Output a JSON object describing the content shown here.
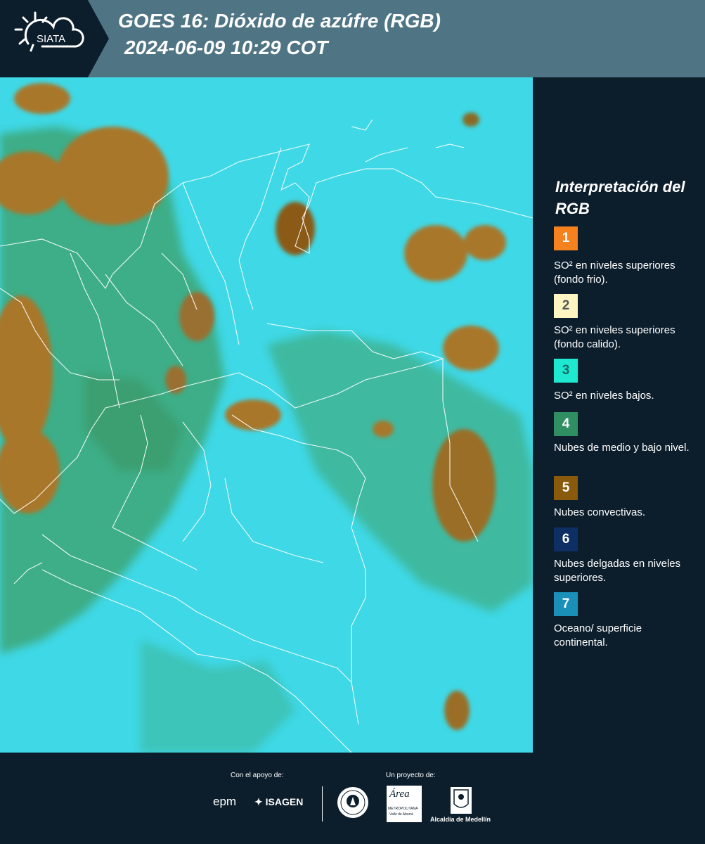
{
  "header": {
    "logo_text": "SIATA",
    "title_line1": "GOES 16: Dióxido de azúfre (RGB)",
    "title_line2": "2024-06-09 10:29 COT"
  },
  "legend": {
    "title": "Interpretación del RGB",
    "items": [
      {
        "num": "1",
        "color": "#f5821f",
        "num_color": "#ffffff",
        "label": "SO² en niveles superiores (fondo frio)."
      },
      {
        "num": "2",
        "color": "#fdf6c3",
        "num_color": "#555555",
        "label": "SO² en niveles superiores (fondo calido)."
      },
      {
        "num": "3",
        "color": "#1ee8d0",
        "num_color": "#1a6a66",
        "label": "SO² en niveles bajos."
      },
      {
        "num": "4",
        "color": "#2f8f63",
        "num_color": "#ffffff",
        "label": "Nubes de medio y bajo nivel."
      },
      {
        "num": "5",
        "color": "#8a5a0c",
        "num_color": "#ffffff",
        "label": "Nubes convectivas."
      },
      {
        "num": "6",
        "color": "#0d2f63",
        "num_color": "#ffffff",
        "label": "Nubes delgadas en niveles superiores."
      },
      {
        "num": "7",
        "color": "#1a8fb8",
        "num_color": "#ffffff",
        "label": "Oceano/ superficie continental."
      }
    ]
  },
  "footer": {
    "support_caption": "Con el apoyo de:",
    "project_caption": "Un proyecto de:",
    "epm_text": "epm",
    "isagen_text": "ISAGEN",
    "area_text": "Área",
    "area_sub": "METROPOLITANA",
    "area_sub2": "Valle de Aburrá",
    "alcaldia_text": "Alcaldía de Medellín"
  },
  "colors": {
    "header_bg": "#4f7585",
    "panel_bg": "#0c1e2c",
    "ocean": "#3fd8e6",
    "land_green": "#3f9a5a",
    "cloud_brown": "#a8772a"
  }
}
